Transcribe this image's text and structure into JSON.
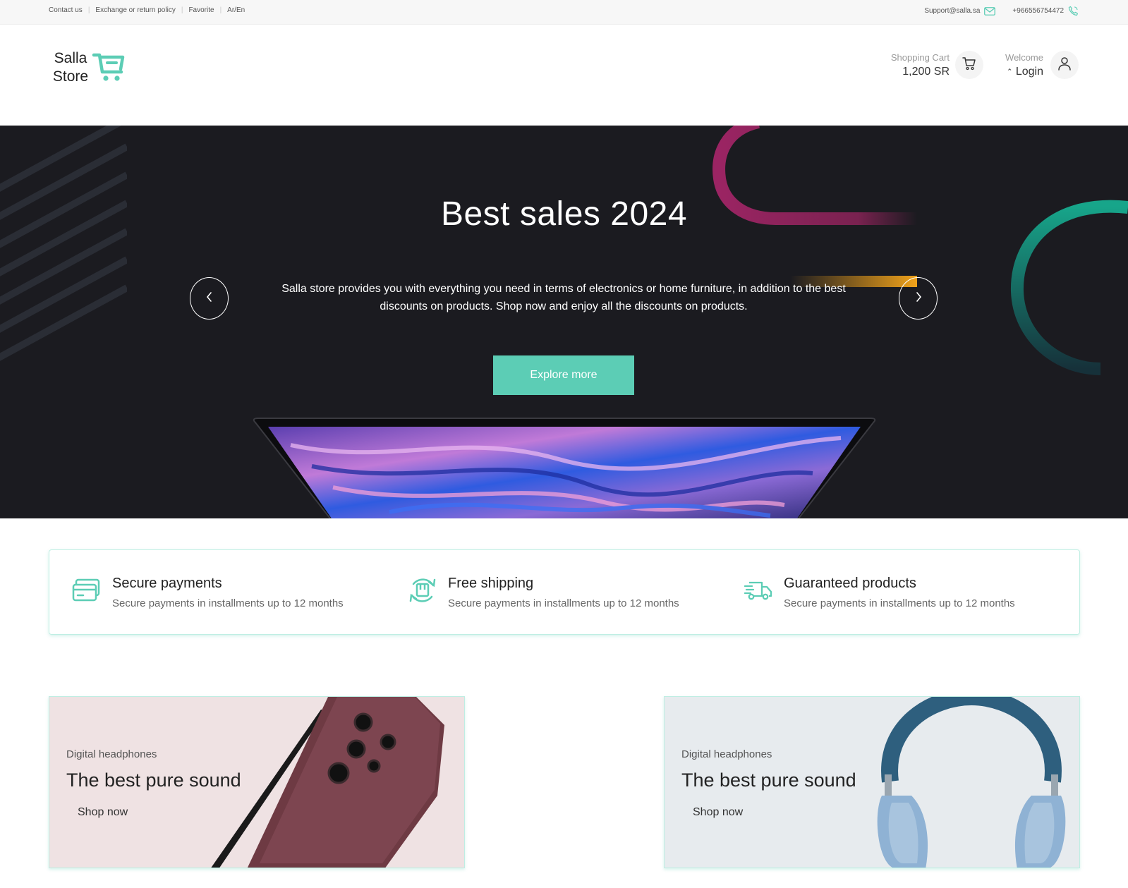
{
  "topbar": {
    "links": [
      "Contact us",
      "Exchange or return policy",
      "Favorite",
      "Ar/En"
    ],
    "email": "Support@salla.sa",
    "phone": "+966556754472",
    "icons": [
      "mail-icon",
      "phone-icon"
    ]
  },
  "header": {
    "logo_line1": "Salla",
    "logo_line2": "Store",
    "cart_label": "Shopping Cart",
    "cart_total": "1,200 SR",
    "welcome_label": "Welcome",
    "login_label": "Login",
    "icons": [
      "cart-icon",
      "user-icon"
    ]
  },
  "hero": {
    "title": "Best sales 2024",
    "description": "Salla store provides you with everything you need in terms of electronics or home furniture, in addition to the best discounts on products. Shop now and enjoy all the discounts on products.",
    "cta_label": "Explore more",
    "icons": [
      "chevron-left-icon",
      "chevron-right-icon"
    ]
  },
  "features": [
    {
      "icon": "credit-card-icon",
      "title": "Secure payments",
      "description": "Secure payments in installments up to 12 months"
    },
    {
      "icon": "refresh-box-icon",
      "title": "Free shipping",
      "description": "Secure payments in installments up to 12 months"
    },
    {
      "icon": "delivery-truck-icon",
      "title": "Guaranteed products",
      "description": "Secure payments in installments up to 12 months"
    }
  ],
  "banners": [
    {
      "subtitle": "Digital headphones",
      "title": "The best pure sound",
      "link": "Shop now"
    },
    {
      "subtitle": "Digital headphones",
      "title": "The best pure sound",
      "link": "Shop now"
    }
  ],
  "colors": {
    "accent": "#5ccdb5",
    "hero_bg": "#1b1b20",
    "topbar_bg": "#f7f7f7",
    "banner_left_bg": "#efe2e3",
    "banner_right_bg": "#e7ebee"
  }
}
